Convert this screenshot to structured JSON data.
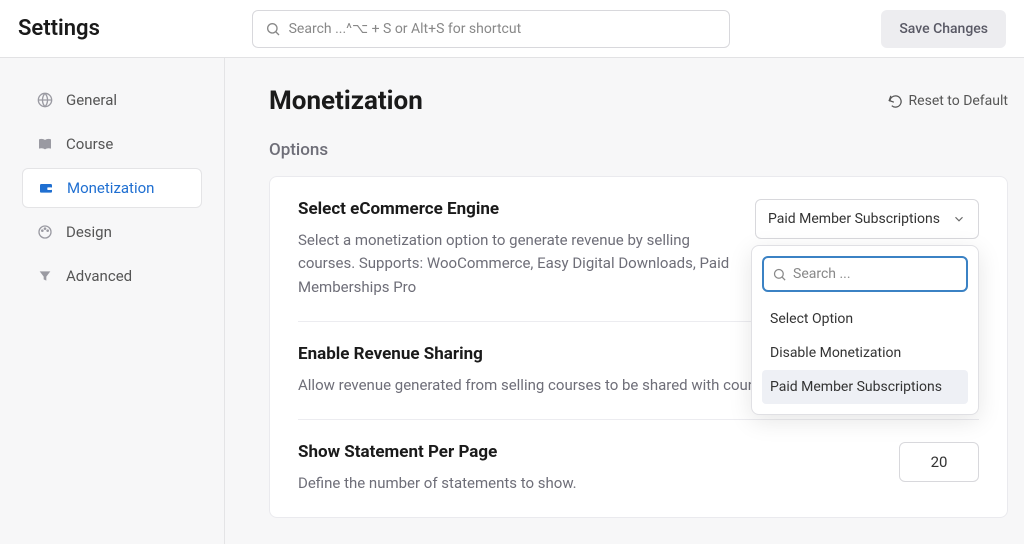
{
  "header": {
    "title": "Settings",
    "searchPlaceholder": "Search ...^⌥ + S or Alt+S for shortcut",
    "saveLabel": "Save Changes"
  },
  "sidebar": {
    "items": [
      {
        "label": "General"
      },
      {
        "label": "Course"
      },
      {
        "label": "Monetization"
      },
      {
        "label": "Design"
      },
      {
        "label": "Advanced"
      }
    ]
  },
  "main": {
    "title": "Monetization",
    "resetLabel": "Reset to Default",
    "optionsLabel": "Options",
    "rows": [
      {
        "title": "Select eCommerce Engine",
        "desc": "Select a monetization option to generate revenue by selling courses. Supports: WooCommerce, Easy Digital Downloads, Paid Memberships Pro",
        "selected": "Paid Member Subscriptions"
      },
      {
        "title": "Enable Revenue Sharing",
        "desc": "Allow revenue generated from selling courses to be shared with course creators."
      },
      {
        "title": "Show Statement Per Page",
        "desc": "Define the number of statements to show.",
        "value": "20"
      }
    ],
    "dropdown": {
      "searchPlaceholder": "Search ...",
      "options": [
        "Select Option",
        "Disable Monetization",
        "Paid Member Subscriptions"
      ]
    }
  }
}
